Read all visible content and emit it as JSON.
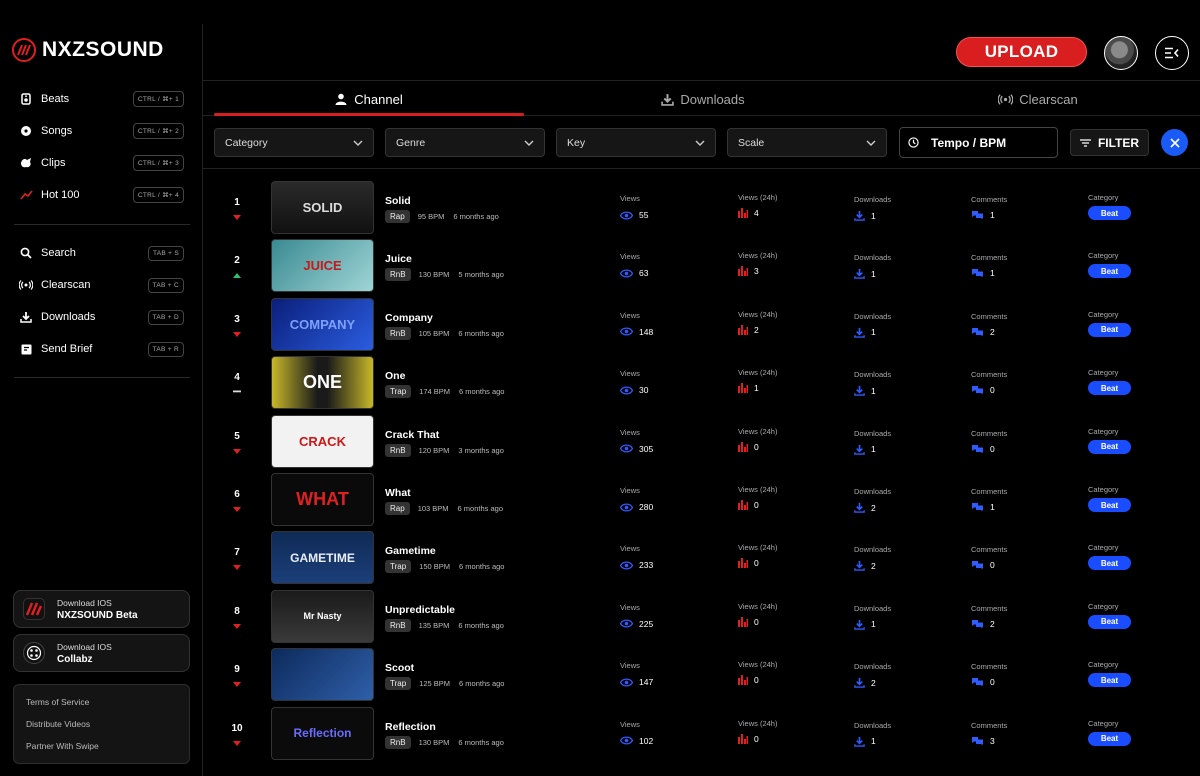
{
  "brand": {
    "name": "NXZSOUND"
  },
  "nav_primary": [
    {
      "label": "Beats",
      "shortcut": "CTRL / ⌘+ 1",
      "icon": "beats-icon"
    },
    {
      "label": "Songs",
      "shortcut": "CTRL / ⌘+ 2",
      "icon": "songs-icon"
    },
    {
      "label": "Clips",
      "shortcut": "CTRL / ⌘+ 3",
      "icon": "clips-icon"
    },
    {
      "label": "Hot 100",
      "shortcut": "CTRL / ⌘+ 4",
      "icon": "trending-icon"
    }
  ],
  "nav_secondary": [
    {
      "label": "Search",
      "shortcut": "TAB + S",
      "icon": "search-icon"
    },
    {
      "label": "Clearscan",
      "shortcut": "TAB + C",
      "icon": "broadcast-icon"
    },
    {
      "label": "Downloads",
      "shortcut": "TAB + D",
      "icon": "download-icon"
    },
    {
      "label": "Send Brief",
      "shortcut": "TAB + R",
      "icon": "brief-icon"
    }
  ],
  "apps": [
    {
      "subtitle": "Download IOS",
      "title": "NXZSOUND Beta"
    },
    {
      "subtitle": "Download IOS",
      "title": "Collabz"
    }
  ],
  "footer_links": [
    "Terms of Service",
    "Distribute Videos",
    "Partner With Swipe"
  ],
  "header": {
    "upload_label": "UPLOAD"
  },
  "tabs": [
    {
      "label": "Channel",
      "active": true
    },
    {
      "label": "Downloads",
      "active": false
    },
    {
      "label": "Clearscan",
      "active": false
    }
  ],
  "filters": {
    "category": "Category",
    "genre": "Genre",
    "key": "Key",
    "scale": "Scale",
    "tempo": "Tempo / BPM",
    "filter_label": "FILTER"
  },
  "labels": {
    "views": "Views",
    "views24": "Views (24h)",
    "downloads": "Downloads",
    "comments": "Comments",
    "category": "Category"
  },
  "colors": {
    "accent_red": "#d81e1e",
    "accent_blue": "#1a4dff",
    "trend_up": "#2fbf71",
    "trend_down": "#e02020"
  },
  "tracks": [
    {
      "rank": "1",
      "trend": "down",
      "title": "Solid",
      "genre": "Rap",
      "bpm": "95 BPM",
      "age": "6 months ago",
      "views": "55",
      "views24": "4",
      "downloads": "1",
      "comments": "1",
      "category": "Beat",
      "art": "SOLID"
    },
    {
      "rank": "2",
      "trend": "up",
      "title": "Juice",
      "genre": "RnB",
      "bpm": "130 BPM",
      "age": "5 months ago",
      "views": "63",
      "views24": "3",
      "downloads": "1",
      "comments": "1",
      "category": "Beat",
      "art": "JUICE"
    },
    {
      "rank": "3",
      "trend": "down",
      "title": "Company",
      "genre": "RnB",
      "bpm": "105 BPM",
      "age": "6 months ago",
      "views": "148",
      "views24": "2",
      "downloads": "1",
      "comments": "2",
      "category": "Beat",
      "art": "COMPANY"
    },
    {
      "rank": "4",
      "trend": "same",
      "title": "One",
      "genre": "Trap",
      "bpm": "174 BPM",
      "age": "6 months ago",
      "views": "30",
      "views24": "1",
      "downloads": "1",
      "comments": "0",
      "category": "Beat",
      "art": "ONE"
    },
    {
      "rank": "5",
      "trend": "down",
      "title": "Crack That",
      "genre": "RnB",
      "bpm": "120 BPM",
      "age": "3 months ago",
      "views": "305",
      "views24": "0",
      "downloads": "1",
      "comments": "0",
      "category": "Beat",
      "art": "CRACK"
    },
    {
      "rank": "6",
      "trend": "down",
      "title": "What",
      "genre": "Rap",
      "bpm": "103 BPM",
      "age": "6 months ago",
      "views": "280",
      "views24": "0",
      "downloads": "2",
      "comments": "1",
      "category": "Beat",
      "art": "WHAT"
    },
    {
      "rank": "7",
      "trend": "down",
      "title": "Gametime",
      "genre": "Trap",
      "bpm": "150 BPM",
      "age": "6 months ago",
      "views": "233",
      "views24": "0",
      "downloads": "2",
      "comments": "0",
      "category": "Beat",
      "art": "GAMETIME"
    },
    {
      "rank": "8",
      "trend": "down",
      "title": "Unpredictable",
      "genre": "RnB",
      "bpm": "135 BPM",
      "age": "6 months ago",
      "views": "225",
      "views24": "0",
      "downloads": "1",
      "comments": "2",
      "category": "Beat",
      "art": "Mr Nasty"
    },
    {
      "rank": "9",
      "trend": "down",
      "title": "Scoot",
      "genre": "Trap",
      "bpm": "125 BPM",
      "age": "6 months ago",
      "views": "147",
      "views24": "0",
      "downloads": "2",
      "comments": "0",
      "category": "Beat",
      "art": ""
    },
    {
      "rank": "10",
      "trend": "down",
      "title": "Reflection",
      "genre": "RnB",
      "bpm": "130 BPM",
      "age": "6 months ago",
      "views": "102",
      "views24": "0",
      "downloads": "1",
      "comments": "3",
      "category": "Beat",
      "art": "Reflection"
    }
  ]
}
